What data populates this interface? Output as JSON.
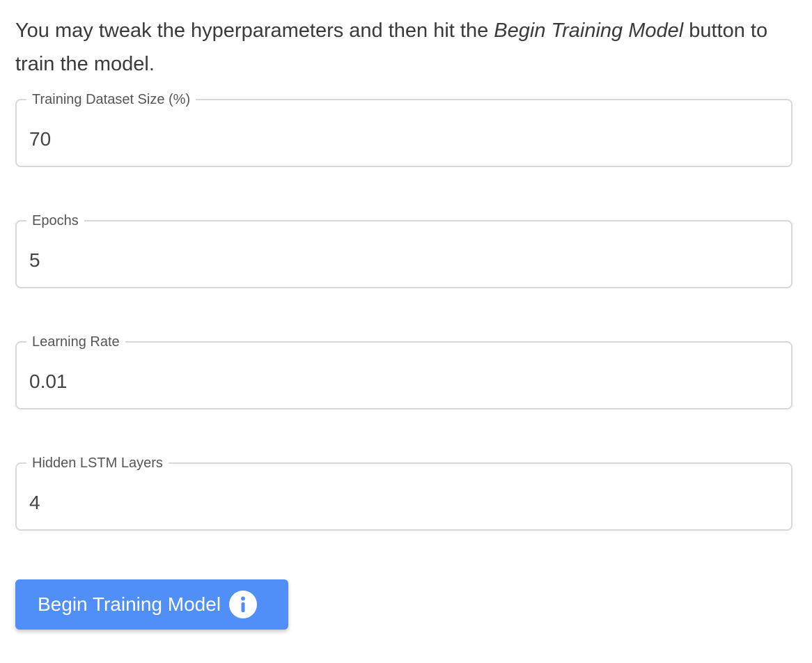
{
  "intro": {
    "text_before": "You may tweak the hyperparameters and then hit the ",
    "emphasis": "Begin Training Model",
    "text_after": " button to train the model."
  },
  "fields": [
    {
      "label": "Training Dataset Size (%)",
      "value": "70"
    },
    {
      "label": "Epochs",
      "value": "5"
    },
    {
      "label": "Learning Rate",
      "value": "0.01"
    },
    {
      "label": "Hidden LSTM Layers",
      "value": "4"
    }
  ],
  "button": {
    "label": "Begin Training Model",
    "icon": "info-icon",
    "color": "#4f8ff7"
  }
}
